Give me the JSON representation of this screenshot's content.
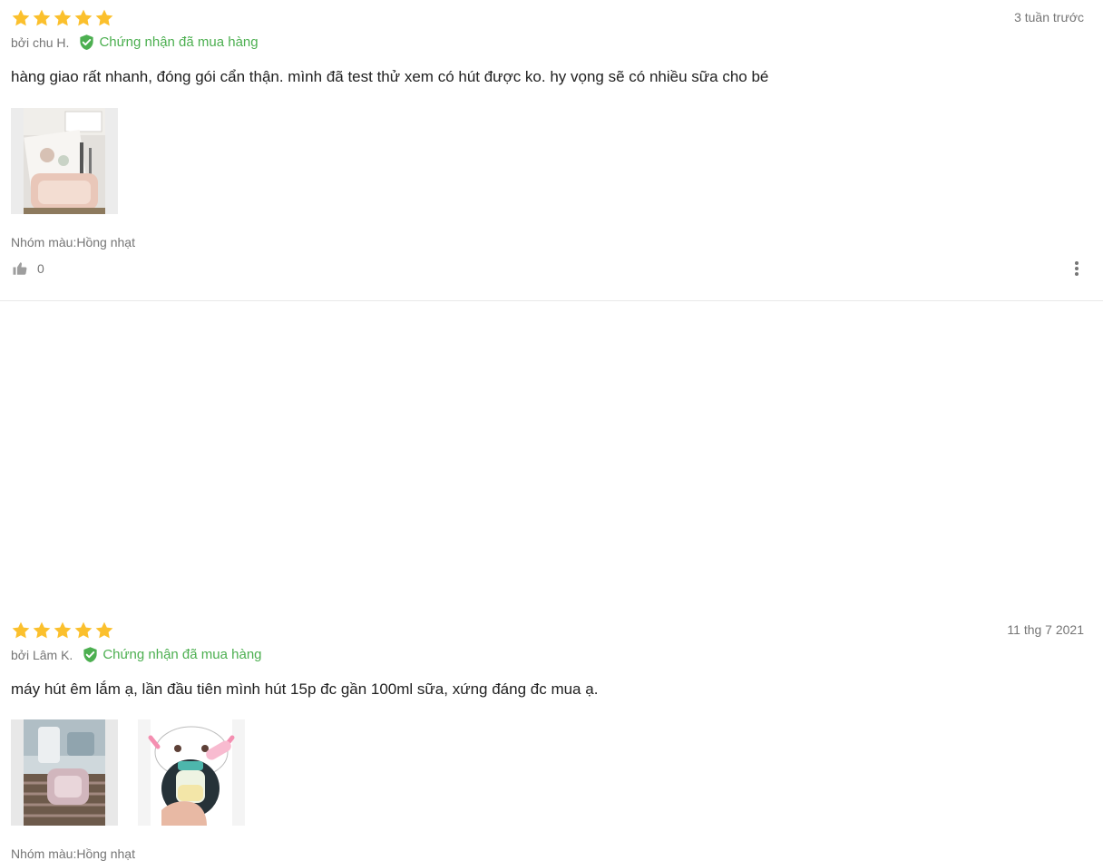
{
  "colors": {
    "star": "#fbc02d",
    "verified": "#4caf50",
    "muted": "#757575",
    "text": "#212121"
  },
  "reviews": [
    {
      "rating": 5,
      "date": "3 tuần trước",
      "author": "bởi chu H.",
      "verified_label": "Chứng nhận đã mua hàng",
      "content": "hàng giao rất nhanh, đóng gói cẩn thận. mình đã test thử xem có hút được ko. hy vọng sẽ có nhiều sữa cho bé",
      "variant": "Nhóm màu:Hồng nhạt",
      "likes": "0",
      "photo_count": 1
    },
    {
      "rating": 5,
      "date": "11 thg 7 2021",
      "author": "bởi Lâm K.",
      "verified_label": "Chứng nhận đã mua hàng",
      "content": "máy hút êm lắm ạ, lần đầu tiên mình hút 15p đc gần 100ml sữa, xứng đáng đc mua ạ.",
      "variant": "Nhóm màu:Hồng nhạt",
      "photo_count": 2
    }
  ]
}
